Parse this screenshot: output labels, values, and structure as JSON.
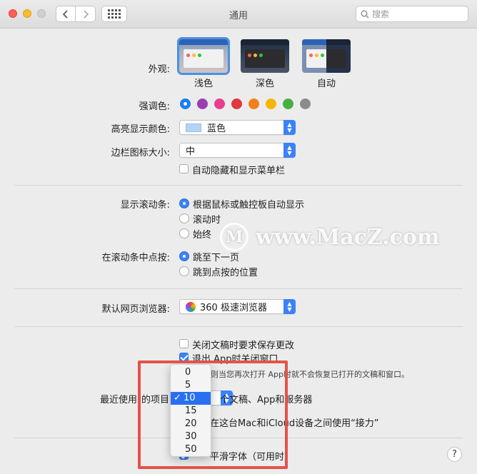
{
  "window": {
    "title": "通用"
  },
  "search": {
    "placeholder": "搜索"
  },
  "appearance": {
    "label": "外观:",
    "options": [
      {
        "label": "浅色",
        "selected": true
      },
      {
        "label": "深色",
        "selected": false
      },
      {
        "label": "自动",
        "selected": false
      }
    ]
  },
  "accent": {
    "label": "强调色:",
    "colors": [
      "#1d7cf2",
      "#9b3fb0",
      "#e93e8f",
      "#e0383e",
      "#f27f1b",
      "#f7b500",
      "#45b03f",
      "#8c8c8c"
    ],
    "selected_index": 0
  },
  "highlight": {
    "label": "高亮显示颜色:",
    "value": "蓝色"
  },
  "sidebar_icon": {
    "label": "边栏图标大小:",
    "value": "中"
  },
  "auto_hide_menu": {
    "label": "自动隐藏和显示菜单栏",
    "checked": false
  },
  "scroll_bars": {
    "label": "显示滚动条:",
    "options": [
      {
        "label": "根据鼠标或触控板自动显示",
        "selected": true
      },
      {
        "label": "滚动时",
        "selected": false
      },
      {
        "label": "始终",
        "selected": false
      }
    ]
  },
  "click_scroll": {
    "label": "在滚动条中点按:",
    "options": [
      {
        "label": "跳至下一页",
        "selected": true
      },
      {
        "label": "跳到点按的位置",
        "selected": false
      }
    ]
  },
  "browser": {
    "label": "默认网页浏览器:",
    "value": "360 极速浏览器"
  },
  "ask_save": {
    "label": "关闭文稿时要求保存更改",
    "checked": false
  },
  "close_windows": {
    "label": "退出 App时关闭窗口",
    "checked": true
  },
  "close_windows_note": "选定，则当您再次打开 App时就不会恢复已打开的文稿和窗口。",
  "recent": {
    "label": "最近使用",
    "label_tail": "的项目:",
    "suffix": "个文稿、App和服务器",
    "menu": [
      "0",
      "5",
      "10",
      "15",
      "20",
      "30",
      "50"
    ],
    "selected": "10"
  },
  "handoff_tail": "在这台Mac和iCloud设备之间使用“接力”",
  "font_smoothing_tail": "平滑字体（可用时）",
  "help": "?",
  "watermark": {
    "logo": "M",
    "text": "www.MacZ.com"
  }
}
